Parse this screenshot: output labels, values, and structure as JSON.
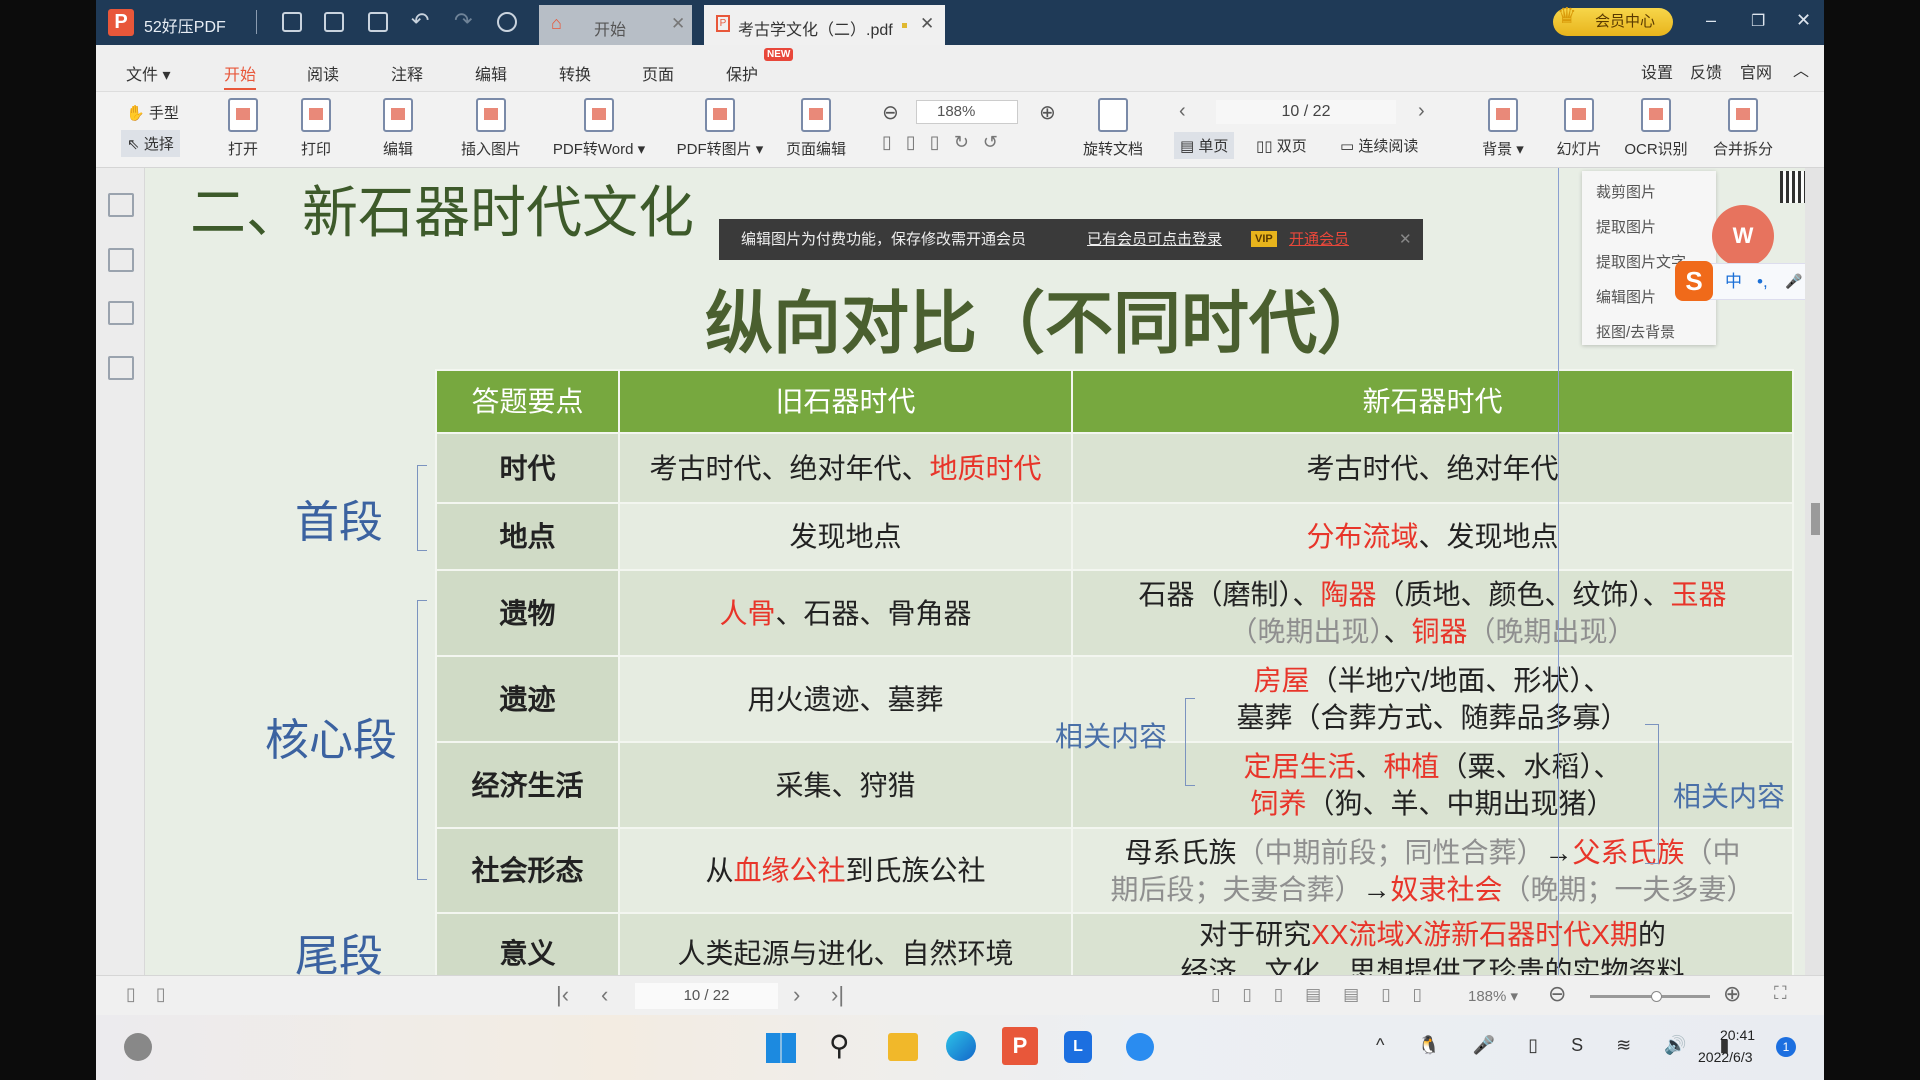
{
  "app": {
    "name": "52好压PDF",
    "tabs": [
      {
        "label": "开始"
      },
      {
        "label": "考古学文化（二）.pdf"
      }
    ],
    "vip_button": "会员中心"
  },
  "menu": {
    "items": [
      "文件 ▾",
      "开始",
      "阅读",
      "注释",
      "编辑",
      "转换",
      "页面",
      "保护"
    ],
    "active": "开始",
    "new_badge": "NEW",
    "right": [
      "设置",
      "反馈",
      "官网"
    ]
  },
  "toolbar": {
    "hand": "手型",
    "select": "选择",
    "tools": [
      "打开",
      "打印",
      "编辑",
      "插入图片",
      "PDF转Word ▾",
      "PDF转图片 ▾",
      "页面编辑"
    ],
    "zoom": "188%",
    "rotate": "旋转文档",
    "page": "10 / 22",
    "single": "单页",
    "double": "双页",
    "continuous": "连续阅读",
    "right_tools": [
      "背景 ▾",
      "幻灯片",
      "OCR识别",
      "合并拆分"
    ]
  },
  "banner": {
    "message": "编辑图片为付费功能，保存修改需开通会员",
    "login_link": "已有会员可点击登录",
    "vip_tag": "VIP",
    "open_vip": "开通会员"
  },
  "context_menu": [
    "裁剪图片",
    "提取图片",
    "提取图片文字",
    "编辑图片",
    "抠图/去背景"
  ],
  "ime": {
    "items": [
      "中",
      "•,",
      "🎤",
      "▦",
      "👕",
      "▣"
    ]
  },
  "document": {
    "heading": "二、新石器时代文化",
    "title": "纵向对比（不同时代）",
    "segments": [
      "首段",
      "核心段",
      "尾段"
    ],
    "related": [
      "相关内容",
      "相关内容"
    ],
    "table": {
      "headers": [
        "答题要点",
        "旧石器时代",
        "新石器时代"
      ],
      "rows": [
        {
          "key": "时代",
          "old": [
            {
              "t": "考古时代、绝对年代、",
              "s": "n"
            },
            {
              "t": "地质时代",
              "s": "r"
            }
          ],
          "new": [
            {
              "t": "考古时代、绝对年代",
              "s": "n"
            }
          ]
        },
        {
          "key": "地点",
          "old": [
            {
              "t": "发现地点",
              "s": "n"
            }
          ],
          "new": [
            {
              "t": "分布流域",
              "s": "r"
            },
            {
              "t": "、发现地点",
              "s": "n"
            }
          ]
        },
        {
          "key": "遗物",
          "old": [
            {
              "t": "人骨",
              "s": "r"
            },
            {
              "t": "、石器、骨角器",
              "s": "n"
            }
          ],
          "new": [
            {
              "t": "石器（磨制）、",
              "s": "n"
            },
            {
              "t": "陶器",
              "s": "r"
            },
            {
              "t": "（质地、颜色、纹饰）、",
              "s": "n"
            },
            {
              "t": "玉器",
              "s": "r"
            },
            {
              "t": "\n（晚期出现）",
              "s": "g"
            },
            {
              "t": "、",
              "s": "n"
            },
            {
              "t": "铜器",
              "s": "r"
            },
            {
              "t": "（晚期出现）",
              "s": "g"
            }
          ]
        },
        {
          "key": "遗迹",
          "old": [
            {
              "t": "用火遗迹、墓葬",
              "s": "n"
            }
          ],
          "new": [
            {
              "t": "房屋",
              "s": "r"
            },
            {
              "t": "（半地穴/地面、形状）、\n墓葬（合葬方式、随葬品多寡）",
              "s": "n"
            }
          ]
        },
        {
          "key": "经济生活",
          "old": [
            {
              "t": "采集、狩猎",
              "s": "n"
            }
          ],
          "new": [
            {
              "t": "定居生活",
              "s": "r"
            },
            {
              "t": "、",
              "s": "n"
            },
            {
              "t": "种植",
              "s": "r"
            },
            {
              "t": "（粟、水稻）、\n",
              "s": "n"
            },
            {
              "t": "饲养",
              "s": "r"
            },
            {
              "t": "（狗、羊、中期出现猪）",
              "s": "n"
            }
          ]
        },
        {
          "key": "社会形态",
          "old": [
            {
              "t": "从",
              "s": "n"
            },
            {
              "t": "血缘公社",
              "s": "r"
            },
            {
              "t": "到氏族公社",
              "s": "n"
            }
          ],
          "new": [
            {
              "t": "母系氏族",
              "s": "n"
            },
            {
              "t": "（中期前段；同性合葬）",
              "s": "g"
            },
            {
              "t": "→",
              "s": "n"
            },
            {
              "t": "父系氏族",
              "s": "r"
            },
            {
              "t": "（中\n期后段；夫妻合葬）",
              "s": "g"
            },
            {
              "t": "→",
              "s": "n"
            },
            {
              "t": "奴隶社会",
              "s": "r"
            },
            {
              "t": "（晚期；一夫多妻）",
              "s": "g"
            }
          ]
        },
        {
          "key": "意义",
          "old": [
            {
              "t": "人类起源与进化、自然环境",
              "s": "n"
            }
          ],
          "new": [
            {
              "t": "对于研究",
              "s": "n"
            },
            {
              "t": "XX流域X游新石器时代X期",
              "s": "r"
            },
            {
              "t": "的\n经济、文化、思想提供了珍贵的实物资料",
              "s": "n"
            }
          ]
        }
      ]
    }
  },
  "statusbar": {
    "page": "10 / 22",
    "zoom": "188% ▾",
    "zoom_slider_percent": 55
  },
  "taskbar": {
    "time": "20:41",
    "date": "2022/6/3",
    "notifications": "1"
  },
  "colors": {
    "titlebar": "#1f3a57",
    "accent": "#e8573a",
    "table_header": "#77a83f",
    "highlight_red": "#e8352a",
    "segment_blue": "#3b62a0"
  }
}
